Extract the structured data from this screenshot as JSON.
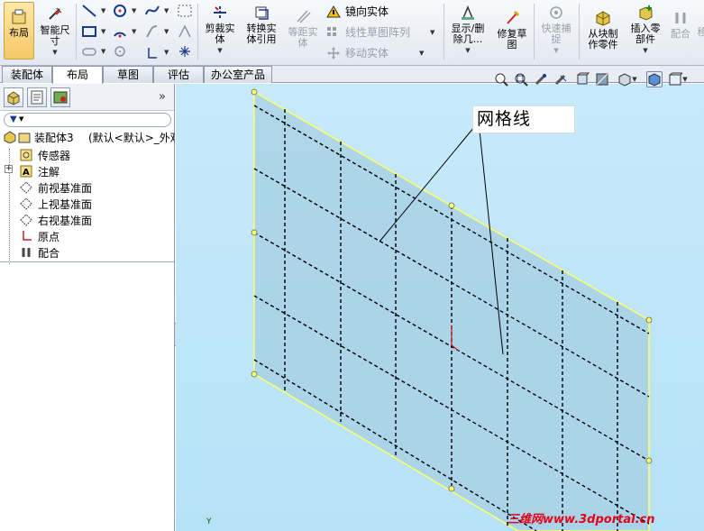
{
  "ribbon": {
    "layout_label": "布局",
    "smart_dim_label": "智能尺\n寸",
    "trim_label": "剪裁实\n体",
    "convert_label": "转换实\n体引用",
    "offset_label": "等距实\n体",
    "mirror_label": "镜向实体",
    "linear_pattern_label": "线性草图阵列",
    "move_label": "移动实体",
    "display_delete_label": "显示/删\n除几...",
    "repair_label": "修复草\n图",
    "quick_snap_label": "快速捕\n捉",
    "from_block_label": "从块制\n作零件",
    "insert_part_label": "插入零\n部件",
    "mate_label": "配合",
    "more_label": "移"
  },
  "tabs": [
    {
      "label": "装配体"
    },
    {
      "label": "布局"
    },
    {
      "label": "草图"
    },
    {
      "label": "评估"
    },
    {
      "label": "办公室产品"
    }
  ],
  "tree": {
    "root": "装配体3",
    "root_config": "(默认<默认>_外观",
    "items": [
      {
        "label": "传感器"
      },
      {
        "label": "注解"
      },
      {
        "label": "前视基准面"
      },
      {
        "label": "上视基准面"
      },
      {
        "label": "右视基准面"
      },
      {
        "label": "原点"
      },
      {
        "label": "配合"
      }
    ],
    "expand_icon": "+"
  },
  "viewport": {
    "callout_text": "网格线",
    "axis_label": "Y",
    "watermark": "三维网www.3dportal.cn"
  },
  "colors": {
    "viewport_bg": "#bde5f8",
    "plane_fill": "#a8cfe4",
    "plane_edge": "#ffff66",
    "grid_line": "#000000",
    "watermark": "#e4001a"
  }
}
